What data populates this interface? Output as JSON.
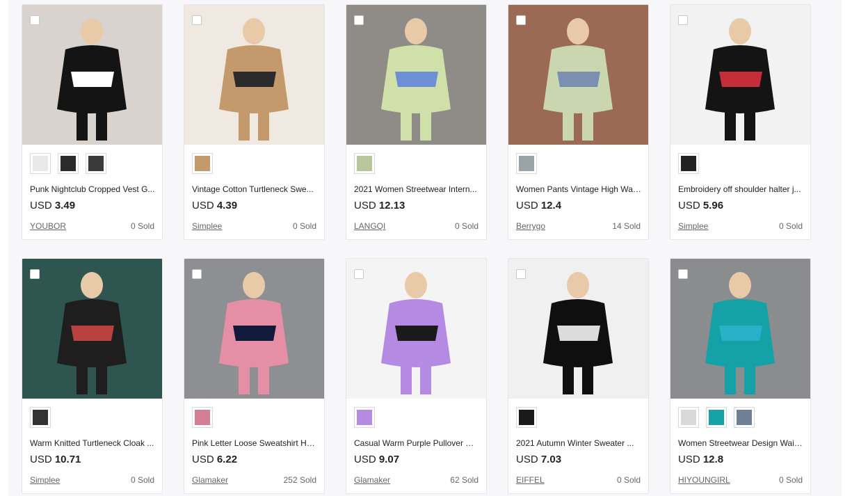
{
  "products": [
    {
      "title": "Punk Nightclub Cropped Vest G...",
      "currency": "USD",
      "price": "3.49",
      "store": "YOUBOR",
      "sold": "0 Sold",
      "image_colors": [
        "#d9d3cf",
        "#141414",
        "#ffffff"
      ],
      "thumbnails": [
        "#e9e9e9",
        "#2a2a2a",
        "#3a3a3a"
      ]
    },
    {
      "title": "Vintage Cotton Turtleneck Swe...",
      "currency": "USD",
      "price": "4.39",
      "store": "Simplee",
      "sold": "0 Sold",
      "image_colors": [
        "#efe9e2",
        "#c49a6c",
        "#2b2b2b"
      ],
      "thumbnails": [
        "#c49a6c"
      ]
    },
    {
      "title": "2021 Women Streetwear Intern...",
      "currency": "USD",
      "price": "12.13",
      "store": "LANGQI",
      "sold": "0 Sold",
      "image_colors": [
        "#8f8c87",
        "#cfe0a8",
        "#6e8fd6"
      ],
      "thumbnails": [
        "#b9c59a"
      ]
    },
    {
      "title": "Women Pants Vintage High Wai...",
      "currency": "USD",
      "price": "12.4",
      "store": "Berrygo",
      "sold": "14 Sold",
      "image_colors": [
        "#9a6a55",
        "#c9d6b0",
        "#7b8fb0"
      ],
      "thumbnails": [
        "#9aa3a6"
      ]
    },
    {
      "title": "Embroidery off shoulder halter j...",
      "currency": "USD",
      "price": "5.96",
      "store": "Simplee",
      "sold": "0 Sold",
      "image_colors": [
        "#f2f2f2",
        "#141414",
        "#c62d3a"
      ],
      "thumbnails": [
        "#222222"
      ]
    },
    {
      "title": "Warm Knitted Turtleneck Cloak ...",
      "currency": "USD",
      "price": "10.71",
      "store": "Simplee",
      "sold": "0 Sold",
      "image_colors": [
        "#2f5550",
        "#1e1e1e",
        "#b9413f"
      ],
      "thumbnails": [
        "#333333"
      ]
    },
    {
      "title": "Pink Letter Loose Sweatshirt Ho...",
      "currency": "USD",
      "price": "6.22",
      "store": "Glamaker",
      "sold": "252 Sold",
      "image_colors": [
        "#8e8f92",
        "#e58fa6",
        "#111a3a"
      ],
      "thumbnails": [
        "#d47f94"
      ]
    },
    {
      "title": "Casual Warm Purple Pullover W...",
      "currency": "USD",
      "price": "9.07",
      "store": "Glamaker",
      "sold": "62 Sold",
      "image_colors": [
        "#f4f4f4",
        "#b58ae3",
        "#1a1a1a"
      ],
      "thumbnails": [
        "#b58ae3"
      ]
    },
    {
      "title": "2021 Autumn Winter Sweater ...",
      "currency": "USD",
      "price": "7.03",
      "store": "EIFFEL",
      "sold": "0 Sold",
      "image_colors": [
        "#f0f0f0",
        "#0f0f0f",
        "#dcdcdc"
      ],
      "thumbnails": [
        "#1a1a1a"
      ]
    },
    {
      "title": "Women Streetwear Design Wais...",
      "currency": "USD",
      "price": "12.8",
      "store": "HIYOUNGIRL",
      "sold": "0 Sold",
      "image_colors": [
        "#8a8c8e",
        "#15a2a6",
        "#27b0c8"
      ],
      "thumbnails": [
        "#d8d8d8",
        "#15a2a6",
        "#6f7f95"
      ]
    }
  ]
}
